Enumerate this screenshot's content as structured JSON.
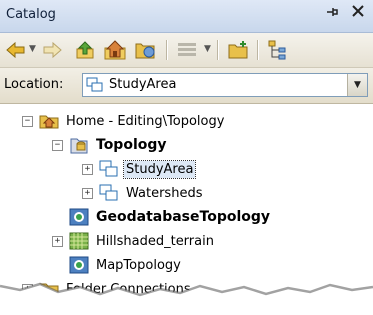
{
  "window": {
    "title": "Catalog",
    "pin_icon": "pin-icon",
    "close_icon": "close-icon"
  },
  "toolbar": {
    "buttons": [
      "back-icon",
      "forward-icon",
      "up-folder-icon",
      "home-folder-icon",
      "folder-connect-icon",
      "view-icon",
      "new-folder-icon",
      "tree-toggle-icon"
    ]
  },
  "location": {
    "label": "Location:",
    "value": "StudyArea"
  },
  "tree": {
    "items": [
      {
        "label": "Home - Editing\\Topology",
        "expander": "−"
      },
      {
        "label": "Topology",
        "expander": "−"
      },
      {
        "label": "StudyArea",
        "expander": "+"
      },
      {
        "label": "Watersheds",
        "expander": "+"
      },
      {
        "label": "GeodatabaseTopology",
        "expander": ""
      },
      {
        "label": "Hillshaded_terrain",
        "expander": "+"
      },
      {
        "label": "MapTopology",
        "expander": ""
      },
      {
        "label": "Folder Connections",
        "expander": "+"
      }
    ]
  },
  "colors": {
    "titlebar": "#c8d7ec",
    "selection": "#dde8f5",
    "folder": "#e8c04a",
    "topology": "#4d80c0"
  }
}
